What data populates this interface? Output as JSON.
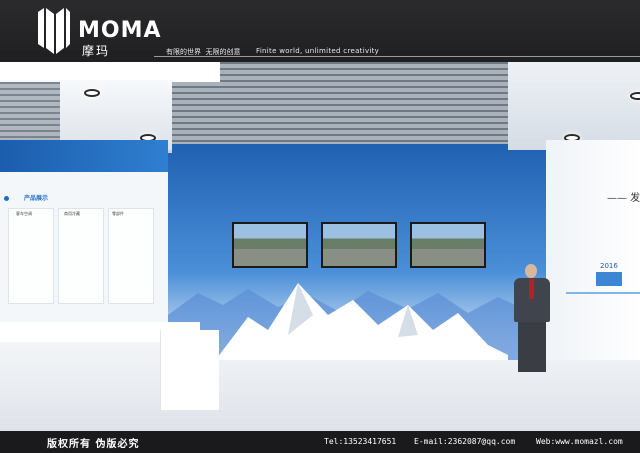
{
  "header": {
    "brand": "MOMA",
    "brand_cn": "摩玛",
    "tagline_cn": "有限的世界  无限的创意",
    "tagline_en": "Finite world, unlimited creativity"
  },
  "scene": {
    "left_title": "产品展示",
    "panel_labels": [
      "客车空调",
      "商用冷藏",
      "零部件"
    ],
    "right_title": "—— 发展历",
    "year": "2016"
  },
  "footer": {
    "copyright": "版权所有 伪版必究",
    "tel": "Tel:13523417651",
    "email": "E-mail:2362087@qq.com",
    "web": "Web:www.momazl.com"
  },
  "colors": {
    "header_bg": "#2b2b2e",
    "accent_blue": "#1f6fc8",
    "wall_blue": "#1f5fb0"
  }
}
